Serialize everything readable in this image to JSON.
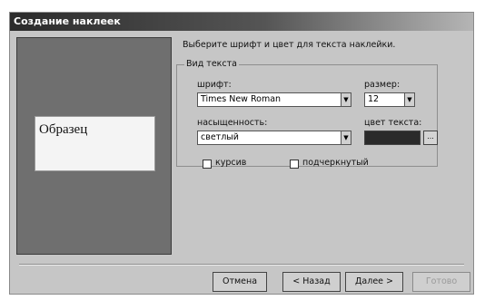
{
  "window": {
    "title": "Создание наклеек"
  },
  "preview": {
    "sample_text": "Образец"
  },
  "instruction": "Выберите шрифт и цвет для текста наклейки.",
  "text_group": {
    "label": "Вид текста",
    "font_label": "шрифт:",
    "font_value": "Times New Roman",
    "size_label": "размер:",
    "size_value": "12",
    "weight_label": "насыщенность:",
    "weight_value": "светлый",
    "color_label": "цвет текста:",
    "color_value_hex": "#2a2a2a",
    "color_button_label": "...",
    "italic_label": "курсив",
    "underline_label": "подчеркнутый",
    "dropdown_icon": "chevron-down-icon"
  },
  "buttons": {
    "cancel": "Отмена",
    "back": "< Назад",
    "next": "Далее >",
    "finish": "Готово"
  }
}
